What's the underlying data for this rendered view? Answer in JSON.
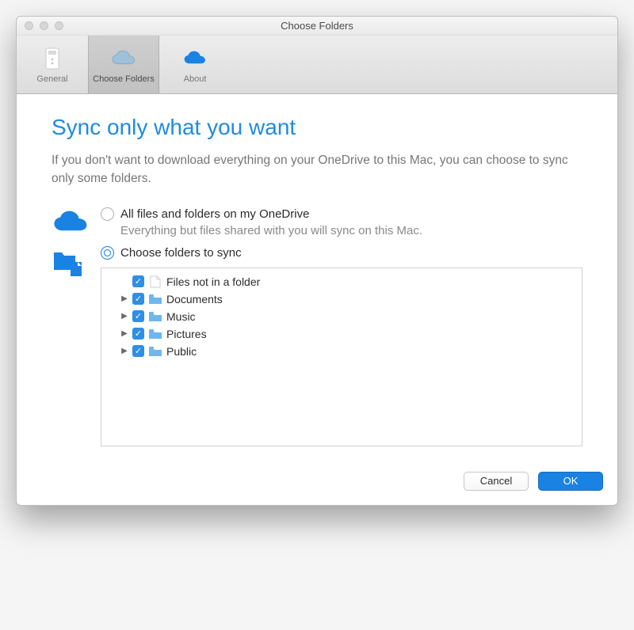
{
  "window": {
    "title": "Choose Folders"
  },
  "toolbar": {
    "items": [
      {
        "label": "General",
        "active": false
      },
      {
        "label": "Choose Folders",
        "active": true
      },
      {
        "label": "About",
        "active": false
      }
    ]
  },
  "content": {
    "heading": "Sync only what you want",
    "description": "If you don't want to download everything on your OneDrive to this Mac, you can choose to sync only some folders."
  },
  "options": {
    "all": {
      "label": "All files and folders on my OneDrive",
      "sub": "Everything but files shared with you will sync on this Mac.",
      "selected": false
    },
    "choose": {
      "label": "Choose folders to sync",
      "selected": true
    }
  },
  "tree": {
    "items": [
      {
        "label": "Files not in a folder",
        "icon": "file",
        "expandable": false,
        "checked": true
      },
      {
        "label": "Documents",
        "icon": "folder",
        "expandable": true,
        "checked": true
      },
      {
        "label": "Music",
        "icon": "folder",
        "expandable": true,
        "checked": true
      },
      {
        "label": "Pictures",
        "icon": "folder",
        "expandable": true,
        "checked": true
      },
      {
        "label": "Public",
        "icon": "folder",
        "expandable": true,
        "checked": true
      }
    ]
  },
  "buttons": {
    "cancel": "Cancel",
    "ok": "OK"
  }
}
